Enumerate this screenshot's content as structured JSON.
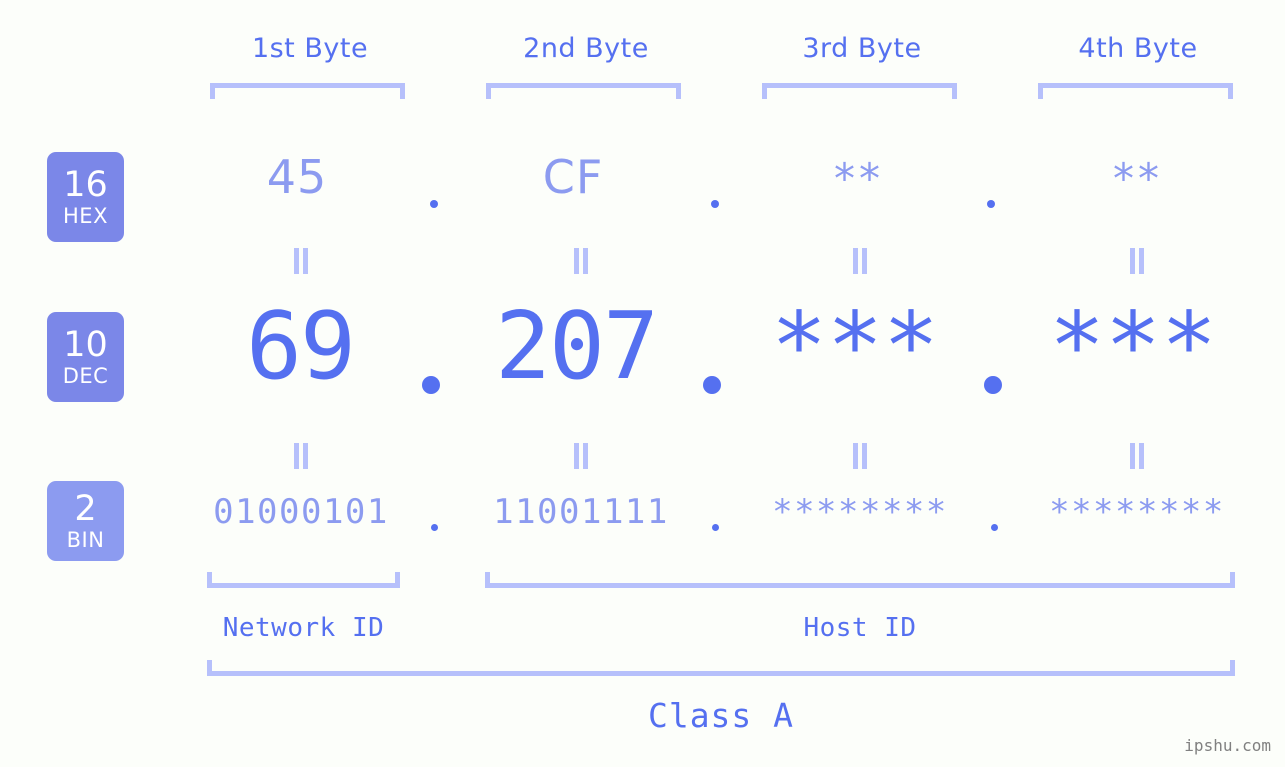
{
  "background_color": "#fcfefa",
  "accent_color": "#5570f0",
  "accent_light_color": "#8c9bf0",
  "bracket_color": "#b6c0fb",
  "badge_color": "#7b87e8",
  "badge_light_color": "#8c9bf0",
  "columns": [
    {
      "header": "1st Byte"
    },
    {
      "header": "2nd Byte"
    },
    {
      "header": "3rd Byte"
    },
    {
      "header": "4th Byte"
    }
  ],
  "rows": {
    "hex": {
      "badge_num": "16",
      "badge_name": "HEX",
      "values": [
        "45",
        "CF",
        "**",
        "**"
      ],
      "separator": "."
    },
    "dec": {
      "badge_num": "10",
      "badge_name": "DEC",
      "values": [
        "69",
        "207",
        "***",
        "***"
      ],
      "separator": "."
    },
    "bin": {
      "badge_num": "2",
      "badge_name": "BIN",
      "values": [
        "01000101",
        "11001111",
        "********",
        "********"
      ],
      "separator": "."
    }
  },
  "equals_marks": {
    "symbol": "||",
    "count_per_row": 4,
    "rows": 2
  },
  "segments": {
    "network_id": "Network ID",
    "host_id": "Host ID",
    "class": "Class A"
  },
  "watermark": "ipshu.com"
}
